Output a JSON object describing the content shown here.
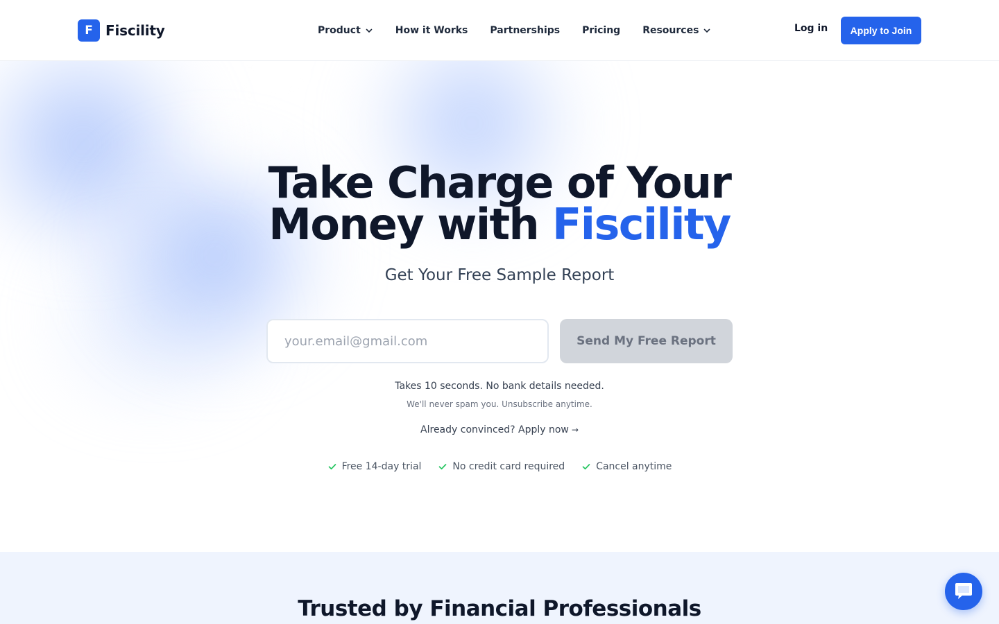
{
  "header": {
    "logo_letter": "F",
    "logo_text": "Fiscility",
    "nav": [
      {
        "label": "Product",
        "has_dropdown": true
      },
      {
        "label": "How it Works",
        "has_dropdown": false
      },
      {
        "label": "Partnerships",
        "has_dropdown": false
      },
      {
        "label": "Pricing",
        "has_dropdown": false
      },
      {
        "label": "Resources",
        "has_dropdown": true
      }
    ],
    "login_label": "Log in",
    "apply_label": "Apply to Join"
  },
  "hero": {
    "title_line1": "Take Charge of Your",
    "title_line2_prefix": "Money with ",
    "title_line2_accent": "Fiscility",
    "subtitle": "Get Your Free Sample Report",
    "email_placeholder": "your.email@gmail.com",
    "email_value": "",
    "send_label": "Send My Free Report",
    "note_primary": "Takes 10 seconds. No bank details needed.",
    "note_secondary": "We'll never spam you. Unsubscribe anytime.",
    "apply_link_text": "Already convinced? Apply now",
    "apply_link_arrow": "→",
    "features": [
      {
        "label": "Free 14-day trial",
        "icon": "check-icon"
      },
      {
        "label": "No credit card required",
        "icon": "check-icon"
      },
      {
        "label": "Cancel anytime",
        "icon": "check-icon"
      }
    ]
  },
  "trusted": {
    "title": "Trusted by Financial Professionals"
  },
  "chat": {
    "icon": "chat-bubble-icon"
  },
  "colors": {
    "accent": "#2563eb",
    "text_dark": "#0f172a",
    "button_disabled": "#d1d5db",
    "check_green": "#22c55e",
    "section_bg": "#eff4fe"
  }
}
